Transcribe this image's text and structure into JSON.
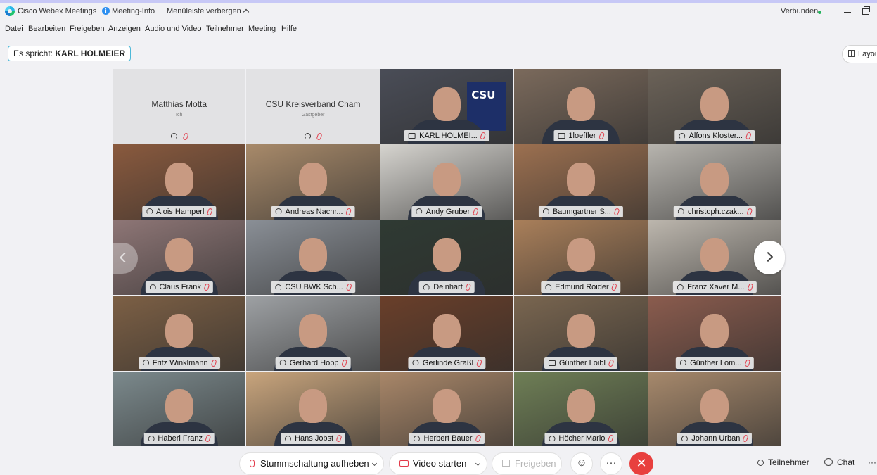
{
  "titlebar": {
    "app_title": "Cisco Webex Meetings",
    "meeting_info": "Meeting-Info",
    "hide_menu": "Menüleiste verbergen",
    "status": "Verbunden"
  },
  "menu": [
    "Datei",
    "Bearbeiten",
    "Freigeben",
    "Anzeigen",
    "Audio und Video",
    "Teilnehmer",
    "Meeting",
    "Hilfe"
  ],
  "speaking": {
    "prefix": "Es spricht:",
    "name": "KARL HOLMEIER"
  },
  "layout_button": "Layout",
  "no_video_participants": [
    {
      "name": "Matthias Motta",
      "role": "Ich"
    },
    {
      "name": "CSU Kreisverband Cham",
      "role": "Gastgeber"
    }
  ],
  "participants": [
    {
      "name": "KARL HOLMEI...",
      "status_icon": "screen-icon",
      "active_speaker": true,
      "bg": "#4a4d57"
    },
    {
      "name": "1loeffler",
      "status_icon": "screen-icon",
      "bg": "#7b6a5c"
    },
    {
      "name": "Alfons Kloster...",
      "status_icon": "headset-icon",
      "bg": "#6b6258"
    },
    {
      "name": "Alois Hamperl",
      "status_icon": "headset-icon",
      "bg": "#8a5a3e"
    },
    {
      "name": "Andreas Nachr...",
      "status_icon": "headset-icon",
      "bg": "#a88a6a"
    },
    {
      "name": "Andy Gruber",
      "status_icon": "headset-icon",
      "bg": "#d6d4cf"
    },
    {
      "name": "Baumgartner S...",
      "status_icon": "headset-icon",
      "bg": "#9c7050"
    },
    {
      "name": "christoph.czak...",
      "status_icon": "headset-icon",
      "bg": "#b7b4ae"
    },
    {
      "name": "Claus Frank",
      "status_icon": "headset-icon",
      "bg": "#8e7676"
    },
    {
      "name": "CSU BWK Sch...",
      "status_icon": "headset-icon",
      "bg": "#8a8f96"
    },
    {
      "name": "Deinhart",
      "status_icon": "headset-icon",
      "bg": "#2f3a33"
    },
    {
      "name": "Edmund Roider",
      "status_icon": "headset-icon",
      "bg": "#a97f5a"
    },
    {
      "name": "Franz Xaver M...",
      "status_icon": "headset-icon",
      "bg": "#bcb6ad"
    },
    {
      "name": "Fritz Winklmann",
      "status_icon": "headset-icon",
      "bg": "#7d6045"
    },
    {
      "name": "Gerhard Hopp",
      "status_icon": "headset-icon",
      "bg": "#9ea1a4"
    },
    {
      "name": "Gerlinde Graßl",
      "status_icon": "headset-icon",
      "bg": "#6a3f2a"
    },
    {
      "name": "Günther Loibl",
      "status_icon": "screen-icon",
      "bg": "#7a6650"
    },
    {
      "name": "Günther Lom...",
      "status_icon": "headset-icon",
      "bg": "#8b5c4e"
    },
    {
      "name": "Haberl Franz",
      "status_icon": "headset-icon",
      "bg": "#7c8a8d"
    },
    {
      "name": "Hans Jobst",
      "status_icon": "headset-icon",
      "bg": "#c9a57d"
    },
    {
      "name": "Herbert Bauer",
      "status_icon": "headset-icon",
      "bg": "#a98769"
    },
    {
      "name": "Höcher Mario",
      "status_icon": "headset-icon",
      "bg": "#6f7f56"
    },
    {
      "name": "Johann Urban",
      "status_icon": "headset-icon",
      "bg": "#a7896c"
    }
  ],
  "controls": {
    "unmute": "Stummschaltung aufheben",
    "start_video": "Video starten",
    "share": "Freigeben",
    "reactions_icon": "smiley-icon",
    "more": "···",
    "end_icon": "close-icon",
    "participants": "Teilnehmer",
    "chat": "Chat",
    "more_right": "···"
  },
  "colors": {
    "accent": "#3ec3ea",
    "end_call": "#e8403e",
    "mute_red": "#e23b4a",
    "connected_green": "#23b35b"
  }
}
